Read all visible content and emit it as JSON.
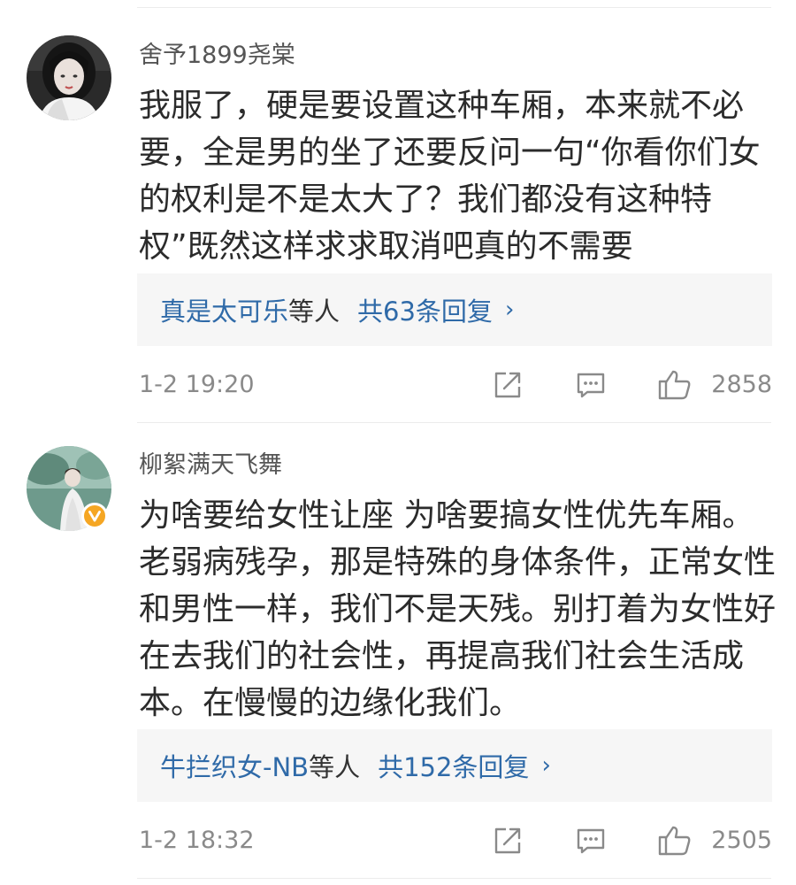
{
  "comments": [
    {
      "username": "舍予1899尧棠",
      "text": "我服了，硬是要设置这种车厢，本来就不必要，全是男的坐了还要反问一句“你看你们女的权利是不是太大了？我们都没有这种特权”既然这样求求取消吧真的不需要",
      "reply_users": "真是太可乐",
      "reply_suffix": "等人",
      "reply_count": "共63条回复",
      "reply_chevron": "›",
      "timestamp": "1-2 19:20",
      "likes": "2858",
      "verified": false
    },
    {
      "username": "柳絮满天飞舞",
      "text": "为啥要给女性让座 为啥要搞女性优先车厢。老弱病残孕，那是特殊的身体条件，正常女性和男性一样，我们不是天残。别打着为女性好在去我们的社会性，再提高我们社会生活成本。在慢慢的边缘化我们。",
      "reply_users": "牛拦织女-NB",
      "reply_suffix": "等人",
      "reply_count": "共152条回复",
      "reply_chevron": "›",
      "timestamp": "1-2 18:32",
      "likes": "2505",
      "verified": true
    }
  ],
  "icons": {
    "share": "share-icon",
    "comment": "comment-icon",
    "like": "thumbs-up-icon",
    "verified": "verified-badge-icon"
  },
  "colors": {
    "link_blue": "#2f6aa8",
    "verified_badge": "#f5a623",
    "meta_gray": "#8a8a8a",
    "reply_bg": "#f6f6f6"
  }
}
